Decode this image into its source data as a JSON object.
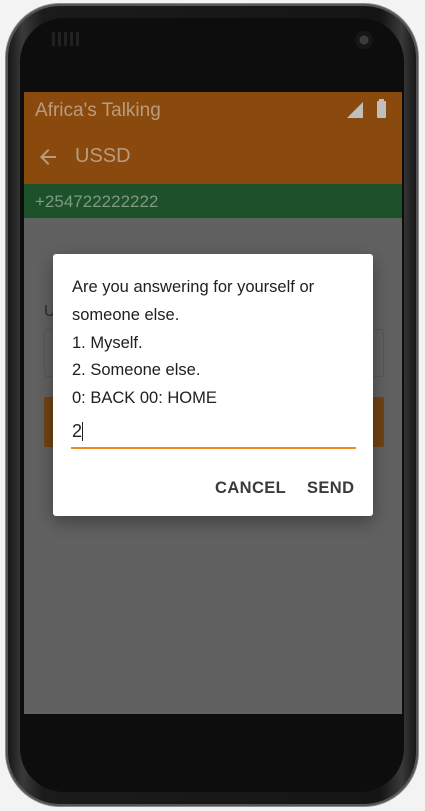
{
  "statusbar": {
    "app_title": "Africa's Talking"
  },
  "appbar": {
    "title": "USSD"
  },
  "phone_strip": {
    "number": "+254722222222"
  },
  "background": {
    "label_partial": "U"
  },
  "dialog": {
    "message": "Are you answering for yourself or\nsomeone else.\n1. Myself.\n2. Someone else.\n0: BACK 00: HOME",
    "input_value": "2",
    "cancel_label": "CANCEL",
    "send_label": "SEND"
  },
  "colors": {
    "toolbar": "#8a4a0d",
    "number_strip": "#1c5129",
    "accent": "#ec8b1f",
    "overlay_screen": "#616161"
  }
}
